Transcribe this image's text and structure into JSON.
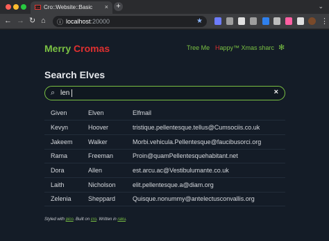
{
  "browser": {
    "tab_favicon_text": "Cro",
    "tab_title": "Cro::Website::Basic",
    "tab_close": "×",
    "new_tab": "+",
    "collapse": "⌄",
    "url_host": "localhost",
    "url_port": ":20000",
    "icons": {
      "back": "back-arrow-icon",
      "forward": "forward-arrow-icon",
      "reload": "reload-icon",
      "home": "home-icon",
      "site_info": "site-info-icon",
      "bookmark": "star-icon",
      "menu": "kebab-menu-icon"
    }
  },
  "header": {
    "brand_first": "Merry",
    "brand_second": " Cromas",
    "nav": {
      "tree": "Tree Me",
      "xmas_h": "H",
      "xmas_rest": "appy™ Xmas",
      "sharc": "sharc"
    }
  },
  "search": {
    "title": "Search Elves",
    "value": "len",
    "clear": "×"
  },
  "table": {
    "headers": [
      "Given",
      "Elven",
      "Elfmail"
    ],
    "rows": [
      [
        "Kevyn",
        "Hoover",
        "tristique.pellentesque.tellus@Cumsociis.co.uk"
      ],
      [
        "Jakeem",
        "Walker",
        "Morbi.vehicula.Pellentesque@faucibusorci.org"
      ],
      [
        "Rama",
        "Freeman",
        "Proin@quamPellentesquehabitant.net"
      ],
      [
        "Dora",
        "Allen",
        "est.arcu.ac@Vestibulumante.co.uk"
      ],
      [
        "Laith",
        "Nicholson",
        "elit.pellentesque.a@diam.org"
      ],
      [
        "Zelenia",
        "Sheppard",
        "Quisque.nonummy@antelectusconvallis.org"
      ]
    ]
  },
  "footer": {
    "t1": "Styled with ",
    "l1": "pico",
    "t2": ". Built on ",
    "l2": "cro",
    "t3": ". Written in ",
    "l3": "raku",
    "t4": "."
  },
  "colors": {
    "accent_green": "#7ac143",
    "accent_red": "#e03030",
    "page_bg": "#141c27"
  }
}
